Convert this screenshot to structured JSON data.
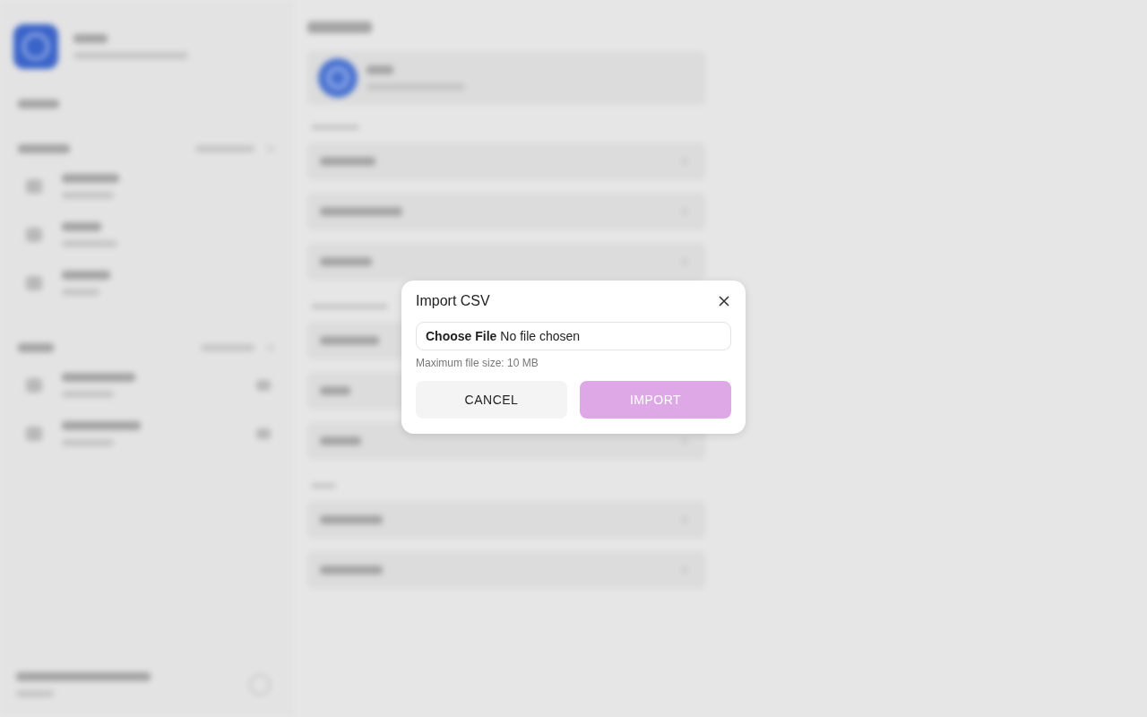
{
  "dialog": {
    "title": "Import CSV",
    "file_input": {
      "button_label": "Choose File",
      "status": "No file chosen"
    },
    "hint": "Maximum file size: 10 MB",
    "buttons": [
      {
        "label": "CANCEL",
        "kind": "secondary",
        "disabled": false
      },
      {
        "label": "IMPORT",
        "kind": "primary",
        "disabled": true
      }
    ]
  }
}
